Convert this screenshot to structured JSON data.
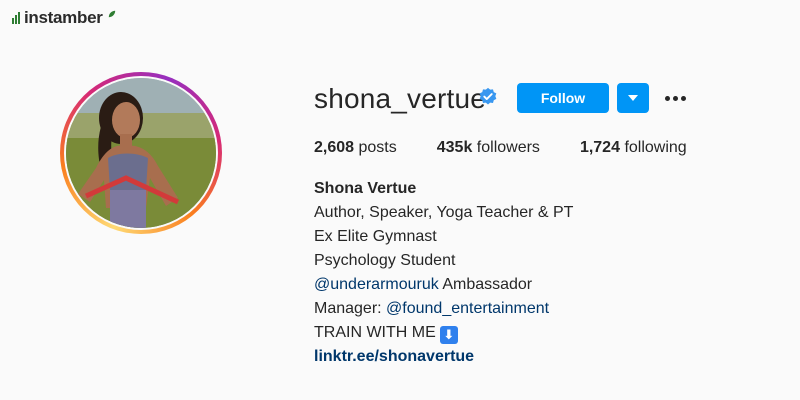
{
  "brand": {
    "name": "instamber",
    "color": "#2e7d32"
  },
  "profile": {
    "username": "shona_vertue",
    "verified": true,
    "verified_icon": "verified-badge-icon",
    "avatar_icon": "profile-photo"
  },
  "actions": {
    "follow_label": "Follow",
    "dropdown_icon": "chevron-down-icon",
    "more_icon": "more-options-icon"
  },
  "stats": {
    "posts_value": "2,608",
    "posts_label": "posts",
    "followers_value": "435k",
    "followers_label": "followers",
    "following_value": "1,724",
    "following_label": "following"
  },
  "bio": {
    "full_name": "Shona Vertue",
    "line1": "Author, Speaker, Yoga Teacher & PT",
    "line2": "Ex Elite Gymnast",
    "line3": "Psychology Student",
    "mention1": "@underarmouruk",
    "mention1_suffix": "Ambassador",
    "manager_prefix": "Manager:",
    "mention2": "@found_entertainment",
    "cta": "TRAIN WITH ME",
    "cta_emoji": "⬇",
    "link": "linktr.ee/shonavertue"
  },
  "colors": {
    "accent": "#0095f6",
    "link": "#00376b",
    "text": "#262626",
    "background": "#fafafa"
  }
}
